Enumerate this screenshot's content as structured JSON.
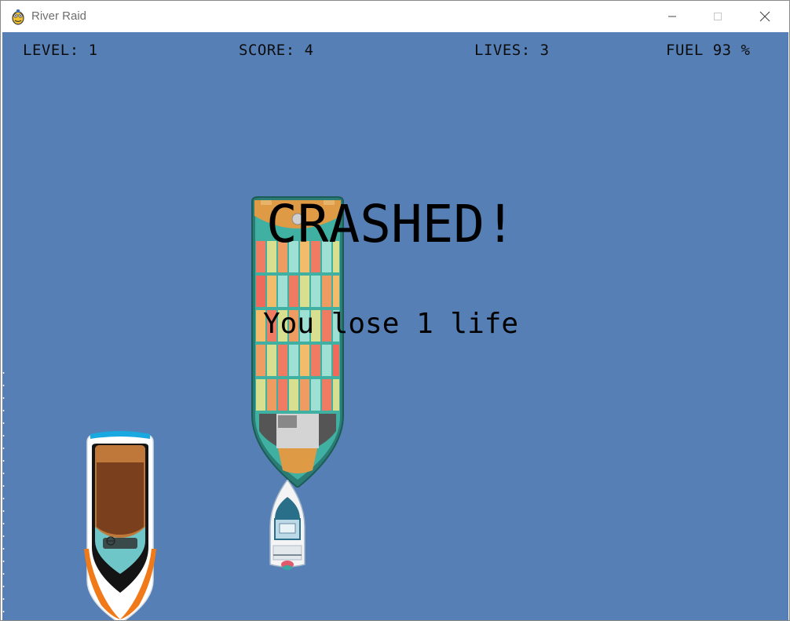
{
  "window": {
    "title": "River Raid",
    "icon": "pygame-snake-icon"
  },
  "hud": {
    "level": "LEVEL: 1",
    "score": "SCORE: 4",
    "lives": "LIVES: 3",
    "fuel": "FUEL 93 %"
  },
  "message": {
    "title": "CRASHED!",
    "subtitle": "You lose 1 life"
  },
  "colors": {
    "river": "#557fb5",
    "hud_text": "#0c0c0c",
    "message_text": "#000000"
  }
}
